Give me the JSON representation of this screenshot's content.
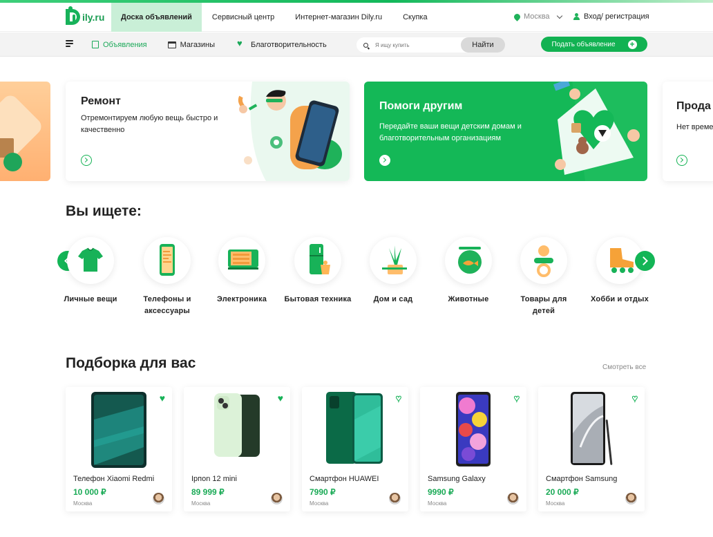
{
  "logo": {
    "text": "ily.ru"
  },
  "top_nav": {
    "tabs": [
      {
        "label": "Доска объявлений",
        "active": true
      },
      {
        "label": "Сервисный центр",
        "active": false
      },
      {
        "label": "Интернет-магазин Dily.ru",
        "active": false
      },
      {
        "label": "Скупка",
        "active": false
      }
    ],
    "city": "Москва",
    "login": "Вход/ регистрация"
  },
  "sub_nav": {
    "items": [
      {
        "label": "Объявления",
        "icon": "ads-icon",
        "active": true
      },
      {
        "label": "Магазины",
        "icon": "shop-icon",
        "active": false
      },
      {
        "label": "Благотворительность",
        "icon": "charity-icon",
        "active": false
      }
    ],
    "search": {
      "placeholder": "Я ищу купить",
      "button": "Найти"
    },
    "post_button": "Подать объявление"
  },
  "banners": [
    {
      "id": "repair",
      "title": "Ремонт",
      "text": "Отремонтируем любую вещь быстро и качественно"
    },
    {
      "id": "help",
      "title": "Помоги другим",
      "text": "Передайте ваши вещи детским домам и благотворительным организациям"
    },
    {
      "id": "sell",
      "title": "Прода",
      "text": "Нет време нам и пол"
    }
  ],
  "categories_title": "Вы ищете:",
  "categories": [
    {
      "label": "Личные вещи",
      "icon": "tshirt-icon"
    },
    {
      "label": "Телефоны и аксессуары",
      "icon": "phone-icon"
    },
    {
      "label": "Электроника",
      "icon": "laptop-icon"
    },
    {
      "label": "Бытовая техника",
      "icon": "fridge-icon"
    },
    {
      "label": "Дом и сад",
      "icon": "plant-icon"
    },
    {
      "label": "Животные",
      "icon": "aquarium-icon"
    },
    {
      "label": "Товары для детей",
      "icon": "pacifier-icon"
    },
    {
      "label": "Хобби и отдых",
      "icon": "rollerskate-icon"
    }
  ],
  "picks": {
    "title": "Подборка для вас",
    "see_all": "Смотреть все",
    "products": [
      {
        "name": "Телефон Xiaomi Redmi",
        "price": "10 000 ₽",
        "city": "Москва",
        "favorite": true,
        "colors": [
          "#0e3a36",
          "#1f8f86"
        ]
      },
      {
        "name": "Iрпоn 12 mini",
        "price": "89 999 ₽",
        "city": "Москва",
        "favorite": true,
        "colors": [
          "#e4f7e0",
          "#c9e9c3"
        ]
      },
      {
        "name": "Смартфон HUAWEI",
        "price": "7990 ₽",
        "city": "Москва",
        "favorite": false,
        "colors": [
          "#0c6e4a",
          "#2cc08f"
        ]
      },
      {
        "name": "Samsung Galaxy",
        "price": "9990 ₽",
        "city": "Москва",
        "favorite": false,
        "colors": [
          "#2b2b2b",
          "#d04aa0"
        ]
      },
      {
        "name": "Смартфон Samsung",
        "price": "20 000 ₽",
        "city": "Москва",
        "favorite": false,
        "colors": [
          "#1b1b1b",
          "#c7cbd1"
        ]
      }
    ]
  },
  "colors": {
    "accent": "#12b252",
    "accent_light": "#c9efd7",
    "text": "#222222"
  }
}
